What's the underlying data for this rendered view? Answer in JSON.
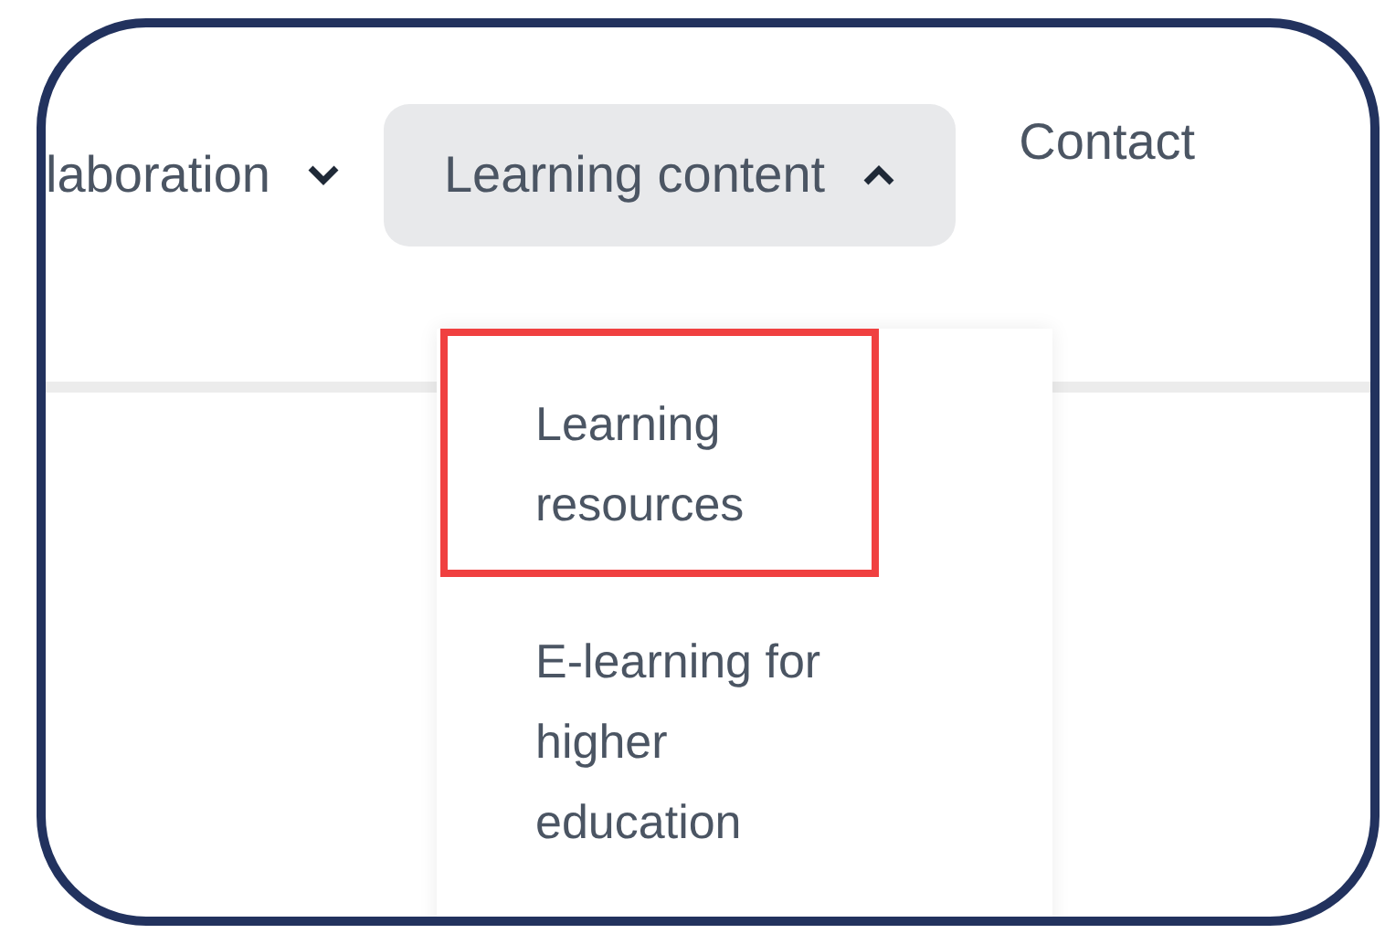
{
  "nav": [
    {
      "label": "laboration",
      "kind": "dropdown",
      "expanded": false
    },
    {
      "label": "Learning content",
      "kind": "dropdown",
      "expanded": true
    },
    {
      "label": "Contact",
      "kind": "link"
    }
  ],
  "dropdown": {
    "items": [
      {
        "label": "Learning resources",
        "highlighted": true
      },
      {
        "label": "E-learning for higher education",
        "highlighted": false
      }
    ]
  }
}
